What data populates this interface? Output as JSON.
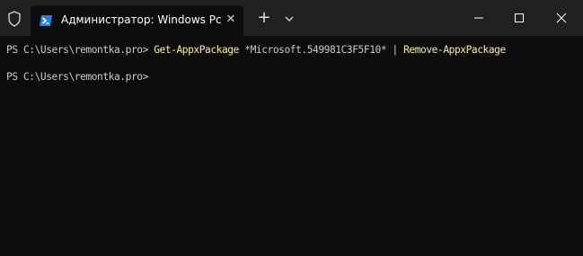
{
  "titlebar": {
    "tab_title": "Администратор: Windows Pc",
    "tab_close_glyph": "✕",
    "new_tab_glyph": "+",
    "dropdown_glyph": "⌵"
  },
  "terminal": {
    "line1": {
      "prompt": "PS C:\\Users\\remontka.pro> ",
      "cmd1": "Get-AppxPackage",
      "param": " *Microsoft.549981C3F5F10* ",
      "pipe": "| ",
      "cmd2": "Remove-AppxPackage"
    },
    "line2": {
      "prompt": "PS C:\\Users\\remontka.pro>"
    }
  },
  "colors": {
    "titlebar_bg": "#202020",
    "terminal_bg": "#0c0c0c",
    "command_yellow": "#f9f1a5",
    "text": "#cccccc"
  },
  "icons": [
    "shield-icon",
    "powershell-icon",
    "close-icon",
    "plus-icon",
    "chevron-down-icon",
    "minimize-icon",
    "maximize-icon",
    "close-window-icon"
  ]
}
